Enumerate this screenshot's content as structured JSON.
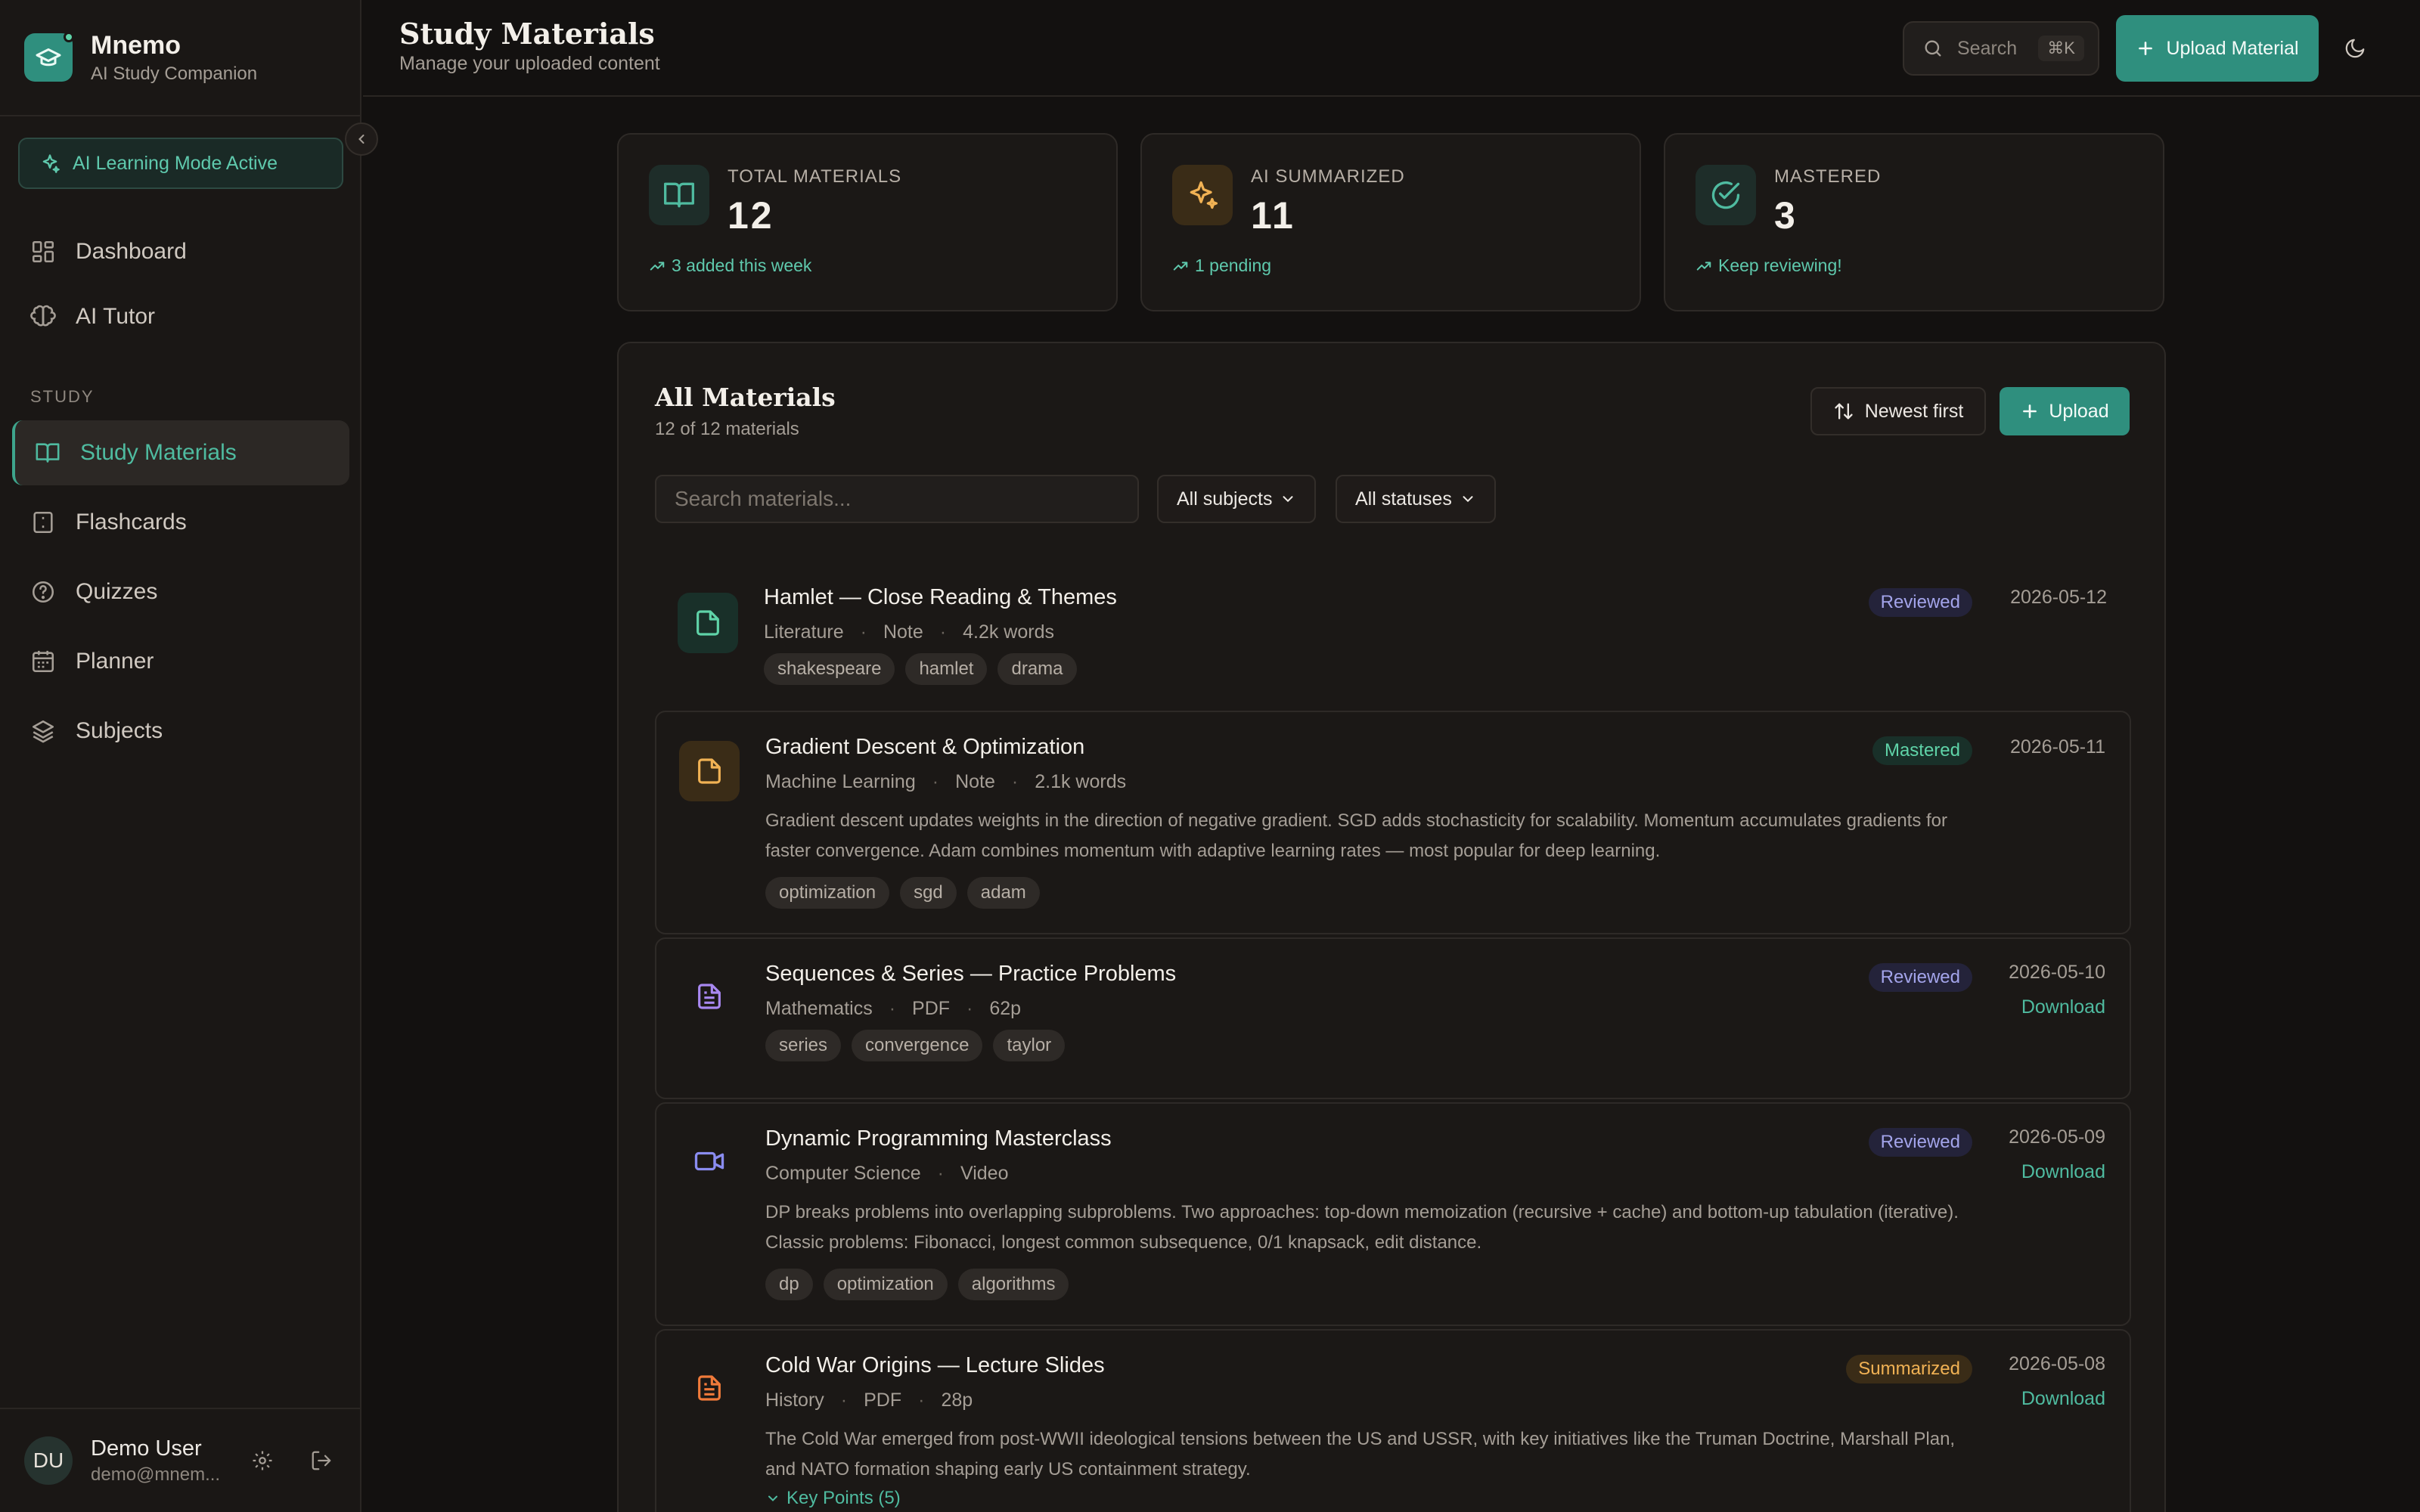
{
  "brand": {
    "name": "Mnemo",
    "subtitle": "AI Study Companion",
    "accent": "#2f8f7e"
  },
  "ai_mode": {
    "label": "AI Learning Mode Active"
  },
  "nav": {
    "top": [
      {
        "label": "Dashboard",
        "icon": "dashboard-icon"
      },
      {
        "label": "AI Tutor",
        "icon": "brain-icon"
      }
    ],
    "group_label": "STUDY",
    "study": [
      {
        "label": "Study Materials",
        "icon": "book-icon",
        "active": true
      },
      {
        "label": "Flashcards",
        "icon": "flashcard-icon"
      },
      {
        "label": "Quizzes",
        "icon": "question-icon"
      },
      {
        "label": "Planner",
        "icon": "calendar-icon"
      },
      {
        "label": "Subjects",
        "icon": "layers-icon"
      }
    ]
  },
  "user": {
    "initials": "DU",
    "name": "Demo User",
    "email": "demo@mnem..."
  },
  "header": {
    "title": "Study Materials",
    "subtitle": "Manage your uploaded content",
    "search_label": "Search",
    "search_shortcut": "⌘K",
    "upload_label": "Upload Material"
  },
  "stats": [
    {
      "label": "TOTAL MATERIALS",
      "value": "12",
      "trend": "3 added this week",
      "icon": "book-icon"
    },
    {
      "label": "AI SUMMARIZED",
      "value": "11",
      "trend": "1 pending",
      "icon": "sparkles-icon"
    },
    {
      "label": "MASTERED",
      "value": "3",
      "trend": "Keep reviewing!",
      "icon": "check-circle-icon"
    }
  ],
  "panel": {
    "title": "All Materials",
    "count_text": "12 of 12 materials",
    "sort_label": "Newest first",
    "upload_label": "Upload",
    "search_placeholder": "Search materials...",
    "filter_subjects": "All subjects",
    "filter_statuses": "All statuses"
  },
  "materials": [
    {
      "title": "Hamlet — Close Reading & Themes",
      "subject": "Literature",
      "type": "Note",
      "size": "4.2k words",
      "status": "Reviewed",
      "date": "2026-05-12",
      "tags": [
        "shakespeare",
        "hamlet",
        "drama"
      ]
    },
    {
      "title": "Gradient Descent & Optimization",
      "subject": "Machine Learning",
      "type": "Note",
      "size": "2.1k words",
      "status": "Mastered",
      "date": "2026-05-11",
      "summary": "Gradient descent updates weights in the direction of negative gradient. SGD adds stochasticity for scalability. Momentum accumulates gradients for faster convergence. Adam combines momentum with adaptive learning rates — most popular for deep learning.",
      "tags": [
        "optimization",
        "sgd",
        "adam"
      ]
    },
    {
      "title": "Sequences & Series — Practice Problems",
      "subject": "Mathematics",
      "type": "PDF",
      "size": "62p",
      "status": "Reviewed",
      "date": "2026-05-10",
      "download": "Download",
      "tags": [
        "series",
        "convergence",
        "taylor"
      ]
    },
    {
      "title": "Dynamic Programming Masterclass",
      "subject": "Computer Science",
      "type": "Video",
      "status": "Reviewed",
      "date": "2026-05-09",
      "download": "Download",
      "summary": "DP breaks problems into overlapping subproblems. Two approaches: top-down memoization (recursive + cache) and bottom-up tabulation (iterative). Classic problems: Fibonacci, longest common subsequence, 0/1 knapsack, edit distance.",
      "tags": [
        "dp",
        "optimization",
        "algorithms"
      ]
    },
    {
      "title": "Cold War Origins — Lecture Slides",
      "subject": "History",
      "type": "PDF",
      "size": "28p",
      "status": "Summarized",
      "date": "2026-05-08",
      "download": "Download",
      "summary": "The Cold War emerged from post-WWII ideological tensions between the US and USSR, with key initiatives like the Truman Doctrine, Marshall Plan, and NATO formation shaping early US containment strategy.",
      "key_points": "Key Points (5)"
    }
  ]
}
